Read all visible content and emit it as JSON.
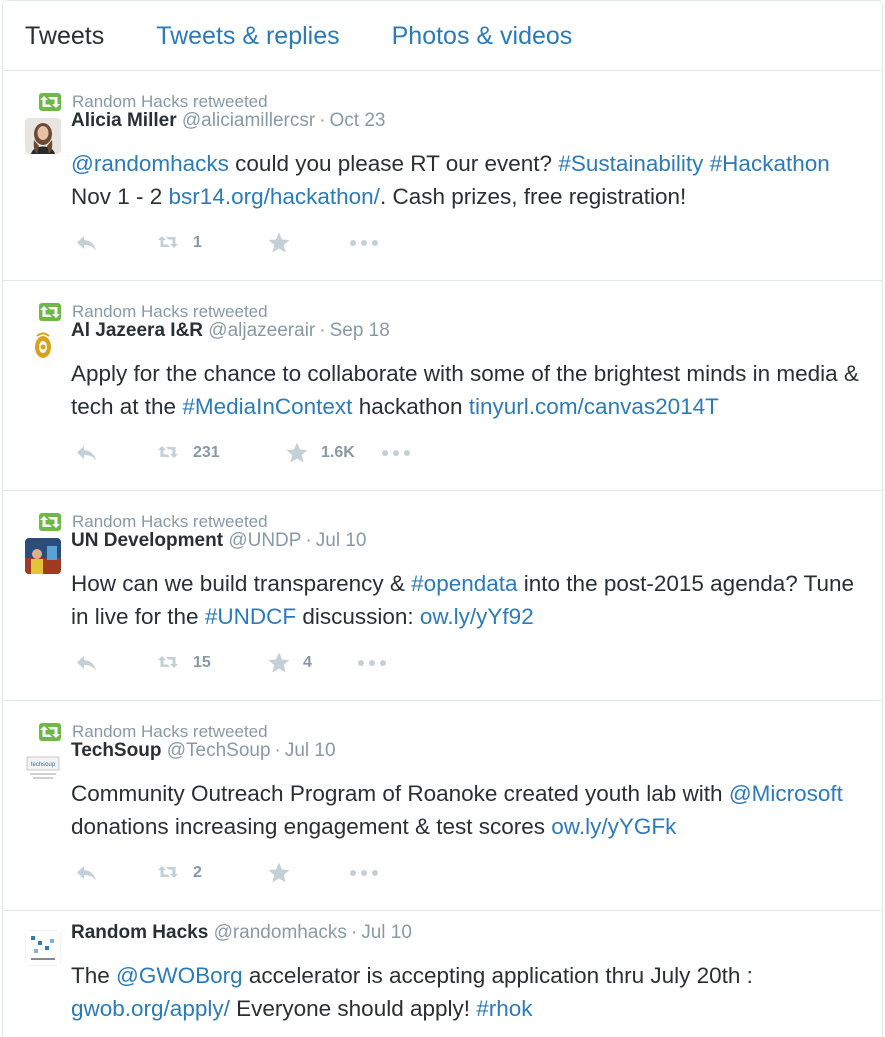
{
  "tabs": [
    "Tweets",
    "Tweets & replies",
    "Photos & videos"
  ],
  "retweeted_label": "Random Hacks retweeted",
  "colors": {
    "link": "#2b7bb9",
    "muted": "#8899a6",
    "retweet_green": "#6eb84a",
    "text": "#292f33"
  },
  "tweets": [
    {
      "retweeted": true,
      "name": "Alicia Miller",
      "handle": "@aliciamillercsr",
      "time": "Oct 23",
      "avatar": "portrait-photo",
      "segments": [
        {
          "t": "@randomhacks",
          "link": true
        },
        {
          "t": " could you please RT our event? ",
          "link": false
        },
        {
          "t": "#Sustainability",
          "link": true
        },
        {
          "t": " ",
          "link": false
        },
        {
          "t": "#Hackathon",
          "link": true
        },
        {
          "t": " Nov 1 - 2 ",
          "link": false
        },
        {
          "t": "bsr14.org/hackathon/",
          "link": true
        },
        {
          "t": ". Cash prizes, free registration!",
          "link": false
        }
      ],
      "retweets": "1",
      "favorites": ""
    },
    {
      "retweeted": true,
      "name": "Al Jazeera I&R",
      "handle": "@aljazeerair",
      "time": "Sep 18",
      "avatar": "aljazeera-logo",
      "segments": [
        {
          "t": "Apply for the chance to collaborate with some of the brightest minds in media & tech at the ",
          "link": false
        },
        {
          "t": "#MediaInContext",
          "link": true
        },
        {
          "t": " hackathon ",
          "link": false
        },
        {
          "t": "tinyurl.com/canvas2014T",
          "link": true
        }
      ],
      "retweets": "231",
      "favorites": "1.6K"
    },
    {
      "retweeted": true,
      "name": "UN Development",
      "handle": "@UNDP",
      "time": "Jul 10",
      "avatar": "undp-photo",
      "segments": [
        {
          "t": "How can we build transparency & ",
          "link": false
        },
        {
          "t": "#opendata",
          "link": true
        },
        {
          "t": " into the post-2015 agenda? Tune in live for the ",
          "link": false
        },
        {
          "t": "#UNDCF",
          "link": true
        },
        {
          "t": " discussion: ",
          "link": false
        },
        {
          "t": "ow.ly/yYf92",
          "link": true
        }
      ],
      "retweets": "15",
      "favorites": "4"
    },
    {
      "retweeted": true,
      "name": "TechSoup",
      "handle": "@TechSoup",
      "time": "Jul 10",
      "avatar": "techsoup-logo",
      "segments": [
        {
          "t": "Community Outreach Program of Roanoke created youth lab with ",
          "link": false
        },
        {
          "t": "@Microsoft",
          "link": true
        },
        {
          "t": " donations increasing engagement & test scores ",
          "link": false
        },
        {
          "t": "ow.ly/yYGFk",
          "link": true
        }
      ],
      "retweets": "2",
      "favorites": ""
    },
    {
      "retweeted": false,
      "name": "Random Hacks",
      "handle": "@randomhacks",
      "time": "Jul 10",
      "avatar": "randomhacks-logo",
      "segments": [
        {
          "t": "The ",
          "link": false
        },
        {
          "t": "@GWOBorg",
          "link": true
        },
        {
          "t": " accelerator is accepting application thru July 20th : ",
          "link": false
        },
        {
          "t": "gwob.org/apply/",
          "link": true
        },
        {
          "t": " Everyone should apply! ",
          "link": false
        },
        {
          "t": "#rhok",
          "link": true
        }
      ],
      "retweets": "",
      "favorites": ""
    }
  ]
}
